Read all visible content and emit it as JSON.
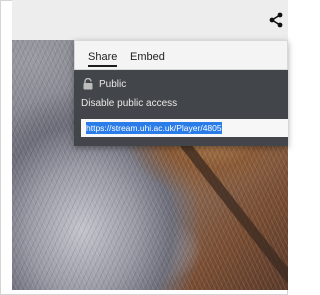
{
  "share_popup": {
    "tabs": [
      {
        "label": "Share",
        "selected": true
      },
      {
        "label": "Embed",
        "selected": false
      }
    ],
    "visibility_label": "Public",
    "disable_link": "Disable public access",
    "share_url": "https://stream.uhi.ac.uk/Player/4805"
  },
  "icons": {
    "toolbar": "share-icon",
    "visibility": "lock-icon"
  },
  "colors": {
    "popup_body": "#424549",
    "selection_highlight": "#2a7ce8",
    "topbar": "#ededed"
  }
}
